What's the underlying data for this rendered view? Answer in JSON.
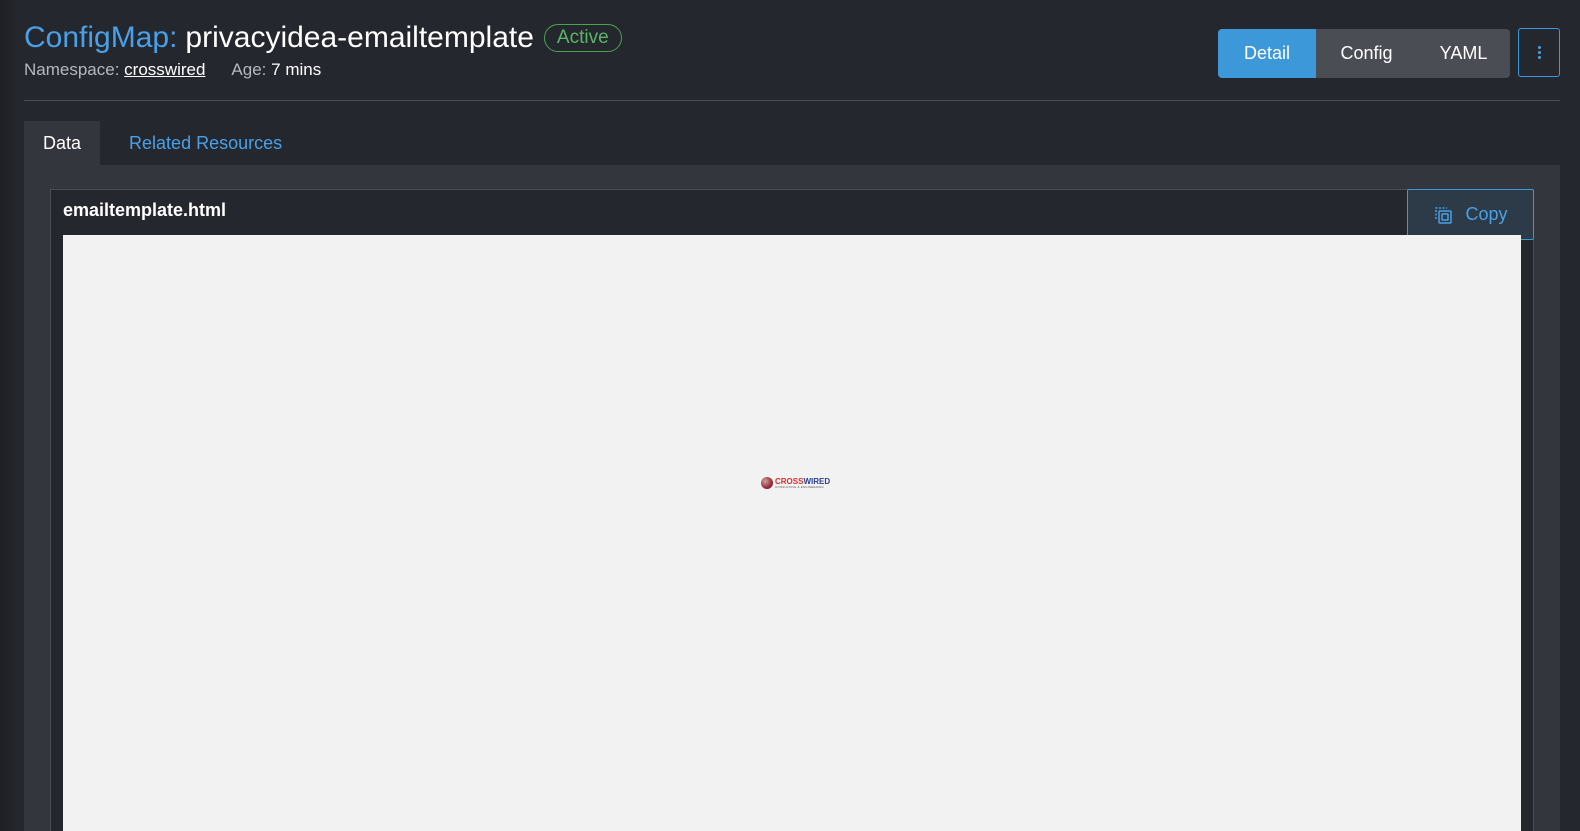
{
  "header": {
    "resource_type": "ConfigMap:",
    "resource_name": "privacyidea-emailtemplate",
    "status": "Active",
    "namespace_label": "Namespace:",
    "namespace_value": "crosswired",
    "age_label": "Age:",
    "age_value": "7 mins"
  },
  "view_switch": {
    "detail": "Detail",
    "config": "Config",
    "yaml": "YAML",
    "active": "Detail"
  },
  "more_button": {
    "icon": "vertical-ellipsis-icon"
  },
  "tabs": [
    {
      "label": "Data",
      "active": true
    },
    {
      "label": "Related Resources",
      "active": false
    }
  ],
  "data_item": {
    "key": "emailtemplate.html",
    "copy_label": "Copy",
    "copy_icon": "copy-icon",
    "preview": {
      "logo_word_part1": "CROSS",
      "logo_word_part2": "WIRED",
      "logo_tagline": "CONSULTING & ENGINEERING"
    }
  },
  "colors": {
    "accent": "#3d98d9",
    "status_active": "#5bb565",
    "background": "#25272e",
    "panel": "#34363e"
  }
}
